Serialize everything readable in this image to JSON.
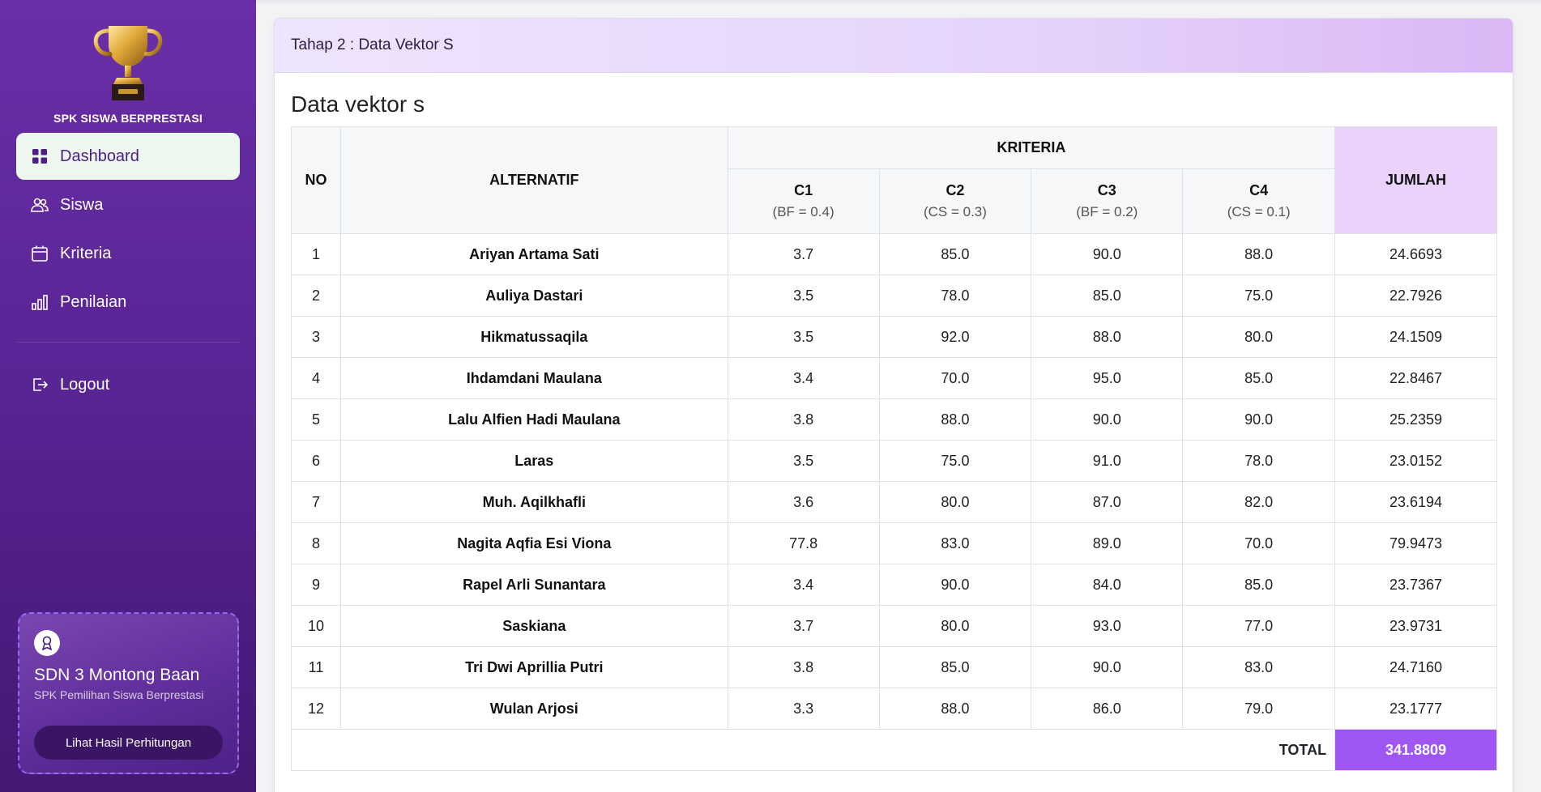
{
  "sidebar": {
    "brand_title": "SPK SISWA BERPRESTASI",
    "nav": [
      {
        "label": "Dashboard",
        "icon": "dashboard-grid-icon",
        "active": true
      },
      {
        "label": "Siswa",
        "icon": "users-icon",
        "active": false
      },
      {
        "label": "Kriteria",
        "icon": "calendar-icon",
        "active": false
      },
      {
        "label": "Penilaian",
        "icon": "bar-chart-icon",
        "active": false
      }
    ],
    "logout_label": "Logout",
    "school_card": {
      "name": "SDN 3 Montong Baan",
      "subtitle": "SPK Pemilihan Siswa Berprestasi",
      "button_label": "Lihat Hasil Perhitungan"
    }
  },
  "main": {
    "card_header": "Tahap 2 : Data Vektor S",
    "section_title": "Data vektor s",
    "table": {
      "headers": {
        "no": "NO",
        "alternatif": "ALTERNATIF",
        "kriteria": "KRITERIA",
        "jumlah": "JUMLAH",
        "criteria": [
          {
            "code": "C1",
            "weight": "(BF = 0.4)"
          },
          {
            "code": "C2",
            "weight": "(CS = 0.3)"
          },
          {
            "code": "C3",
            "weight": "(BF = 0.2)"
          },
          {
            "code": "C4",
            "weight": "(CS = 0.1)"
          }
        ]
      },
      "rows": [
        {
          "no": "1",
          "name": "Ariyan Artama Sati",
          "c1": "3.7",
          "c2": "85.0",
          "c3": "90.0",
          "c4": "88.0",
          "jumlah": "24.6693"
        },
        {
          "no": "2",
          "name": "Auliya Dastari",
          "c1": "3.5",
          "c2": "78.0",
          "c3": "85.0",
          "c4": "75.0",
          "jumlah": "22.7926"
        },
        {
          "no": "3",
          "name": "Hikmatussaqila",
          "c1": "3.5",
          "c2": "92.0",
          "c3": "88.0",
          "c4": "80.0",
          "jumlah": "24.1509"
        },
        {
          "no": "4",
          "name": "Ihdamdani Maulana",
          "c1": "3.4",
          "c2": "70.0",
          "c3": "95.0",
          "c4": "85.0",
          "jumlah": "22.8467"
        },
        {
          "no": "5",
          "name": "Lalu Alfien Hadi Maulana",
          "c1": "3.8",
          "c2": "88.0",
          "c3": "90.0",
          "c4": "90.0",
          "jumlah": "25.2359"
        },
        {
          "no": "6",
          "name": "Laras",
          "c1": "3.5",
          "c2": "75.0",
          "c3": "91.0",
          "c4": "78.0",
          "jumlah": "23.0152"
        },
        {
          "no": "7",
          "name": "Muh. Aqilkhafli",
          "c1": "3.6",
          "c2": "80.0",
          "c3": "87.0",
          "c4": "82.0",
          "jumlah": "23.6194"
        },
        {
          "no": "8",
          "name": "Nagita Aqfia Esi Viona",
          "c1": "77.8",
          "c2": "83.0",
          "c3": "89.0",
          "c4": "70.0",
          "jumlah": "79.9473"
        },
        {
          "no": "9",
          "name": "Rapel Arli Sunantara",
          "c1": "3.4",
          "c2": "90.0",
          "c3": "84.0",
          "c4": "85.0",
          "jumlah": "23.7367"
        },
        {
          "no": "10",
          "name": "Saskiana",
          "c1": "3.7",
          "c2": "80.0",
          "c3": "93.0",
          "c4": "77.0",
          "jumlah": "23.9731"
        },
        {
          "no": "11",
          "name": "Tri Dwi Aprillia Putri",
          "c1": "3.8",
          "c2": "85.0",
          "c3": "90.0",
          "c4": "83.0",
          "jumlah": "24.7160"
        },
        {
          "no": "12",
          "name": "Wulan Arjosi",
          "c1": "3.3",
          "c2": "88.0",
          "c3": "86.0",
          "c4": "79.0",
          "jumlah": "23.1777"
        }
      ],
      "total_label": "TOTAL",
      "total_value": "341.8809"
    }
  },
  "colors": {
    "sidebar_top": "#6a2fa8",
    "sidebar_bottom": "#431873",
    "accent": "#a056f3",
    "header_tint": "#e6d4fb",
    "jumlah_header": "#e9d3fb"
  }
}
